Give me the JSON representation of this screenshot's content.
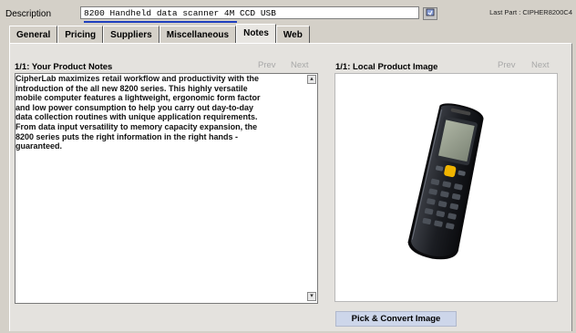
{
  "description": {
    "label": "Description",
    "value": "8200 Handheld data scanner 4M CCD USB",
    "lookup_icon": "lookup-icon"
  },
  "last_part": "Last Part : CIPHER8200C4",
  "tabs": [
    {
      "label": "General"
    },
    {
      "label": "Pricing"
    },
    {
      "label": "Suppliers"
    },
    {
      "label": "Miscellaneous"
    },
    {
      "label": "Notes",
      "active": true
    },
    {
      "label": "Web"
    }
  ],
  "notes": {
    "title": "1/1: Your Product Notes",
    "prev": "Prev",
    "next": "Next",
    "lines": [
      "CipherLab maximizes retail workflow and productivity with the",
      "introduction of the all new 8200 series. This highly versatile",
      "mobile computer features a lightweight, ergonomic form factor",
      "and low power consumption to help you carry out day-to-day",
      "data collection routines with unique application requirements.",
      "From data input versatility to memory capacity expansion, the",
      "8200 series puts the right information in the right hands -",
      "guaranteed."
    ]
  },
  "image": {
    "title": "1/1: Local Product Image",
    "prev": "Prev",
    "next": "Next",
    "pick_label": "Pick & Convert Image"
  },
  "colors": {
    "background": "#d4d0c8",
    "panel": "#e4e2de",
    "underline": "#1f3fbf",
    "pick_button": "#cdd6ea"
  }
}
